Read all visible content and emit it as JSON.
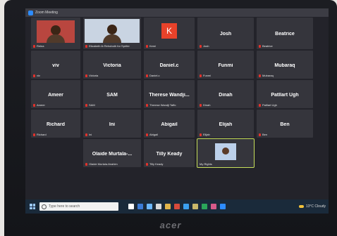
{
  "window": {
    "title": "Zoom Meeting"
  },
  "participants": [
    {
      "name": "",
      "label": "Reina",
      "type": "video"
    },
    {
      "name": "",
      "label": "Elizabeth ib Rehoboth for Sprifer",
      "type": "video-wide"
    },
    {
      "name": "K",
      "label": "Kemi",
      "type": "avatar"
    },
    {
      "name": "Josh",
      "label": "Josh",
      "type": "name"
    },
    {
      "name": "Beatrice",
      "label": "Beatrice",
      "type": "name"
    },
    {
      "name": "viv",
      "label": "viv",
      "type": "name"
    },
    {
      "name": "Victoria",
      "label": "Victoria",
      "type": "name"
    },
    {
      "name": "Daniel.c",
      "label": "Daniel.c",
      "type": "name"
    },
    {
      "name": "Funmi",
      "label": "Funmi",
      "type": "name"
    },
    {
      "name": "Mubaraq",
      "label": "Mubaraq",
      "type": "name"
    },
    {
      "name": "Ameer",
      "label": "Ameer",
      "type": "name"
    },
    {
      "name": "SAM",
      "label": "SAM",
      "type": "name"
    },
    {
      "name": "Therese Wandji...",
      "label": "Therese Wandji Taffo",
      "type": "name"
    },
    {
      "name": "Dinah",
      "label": "Dinah",
      "type": "name"
    },
    {
      "name": "Patllart Ugh",
      "label": "Patllart Ugh",
      "type": "name"
    },
    {
      "name": "Richard",
      "label": "Richard",
      "type": "name"
    },
    {
      "name": "Ini",
      "label": "Ini",
      "type": "name"
    },
    {
      "name": "Abigail",
      "label": "Abigail",
      "type": "name"
    },
    {
      "name": "Elijah",
      "label": "Elijah",
      "type": "name"
    },
    {
      "name": "Ben",
      "label": "Ben",
      "type": "name"
    },
    {
      "name": "",
      "label": "",
      "type": "empty"
    },
    {
      "name": "Olaide Murtala-...",
      "label": "Olaide Murtala-Ibrahim",
      "type": "name"
    },
    {
      "name": "Tilly Keady",
      "label": "Tilly Keady",
      "type": "name"
    },
    {
      "name": "",
      "label": "My Rights",
      "type": "active-video"
    },
    {
      "name": "",
      "label": "",
      "type": "empty"
    }
  ],
  "taskbar": {
    "search_placeholder": "Type here to search",
    "weather": "13°C Cloudy",
    "icon_colors": [
      "#ffffff",
      "#3b7bd6",
      "#6cb8ff",
      "#d9d9d9",
      "#e0b44a",
      "#d64a3b",
      "#3ba0f0",
      "#c9b86a",
      "#2aa55a",
      "#d65a8a",
      "#2d8cff"
    ]
  },
  "device": {
    "brand": "acer"
  }
}
